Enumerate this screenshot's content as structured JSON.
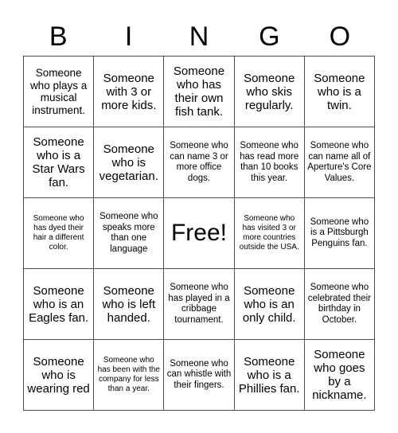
{
  "header": {
    "letters": [
      "B",
      "I",
      "N",
      "G",
      "O"
    ]
  },
  "grid": {
    "rows": 5,
    "columns": 5,
    "cells": [
      {
        "text": "Someone who plays a musical instrument.",
        "size": "md"
      },
      {
        "text": "Someone with 3 or more kids.",
        "size": "lg"
      },
      {
        "text": "Someone who has their own fish tank.",
        "size": "lg"
      },
      {
        "text": "Someone who skis regularly.",
        "size": "lg"
      },
      {
        "text": "Someone who is a twin.",
        "size": "lg"
      },
      {
        "text": "Someone who is a Star Wars fan.",
        "size": "lg"
      },
      {
        "text": "Someone who is vegetarian.",
        "size": "lg"
      },
      {
        "text": "Someone who can name 3 or more office dogs.",
        "size": "sm"
      },
      {
        "text": "Someone who has read more than 10 books this year.",
        "size": "sm"
      },
      {
        "text": "Someone who can name all of Aperture's Core Values.",
        "size": "sm"
      },
      {
        "text": "Someone who has dyed their hair a different color.",
        "size": "xs"
      },
      {
        "text": "Someone who speaks more than one language",
        "size": "sm"
      },
      {
        "text": "Free!",
        "size": "xl"
      },
      {
        "text": "Someone who has visited 3 or more countries outside the USA.",
        "size": "xs"
      },
      {
        "text": "Someone who is a Pittsburgh Penguins fan.",
        "size": "sm"
      },
      {
        "text": "Someone who is an Eagles fan.",
        "size": "lg"
      },
      {
        "text": "Someone who is left handed.",
        "size": "lg"
      },
      {
        "text": "Someone who has played in a cribbage tournament.",
        "size": "sm"
      },
      {
        "text": "Someone who is an only child.",
        "size": "lg"
      },
      {
        "text": "Someone who celebrated their birthday in October.",
        "size": "sm"
      },
      {
        "text": "Someone who is wearing red",
        "size": "lg"
      },
      {
        "text": "Someone who has been with the company for less than a year.",
        "size": "xs"
      },
      {
        "text": "Someone who can whistle with their fingers.",
        "size": "sm"
      },
      {
        "text": "Someone who is a Phillies fan.",
        "size": "lg"
      },
      {
        "text": "Someone who goes by a nickname.",
        "size": "lg"
      }
    ]
  }
}
